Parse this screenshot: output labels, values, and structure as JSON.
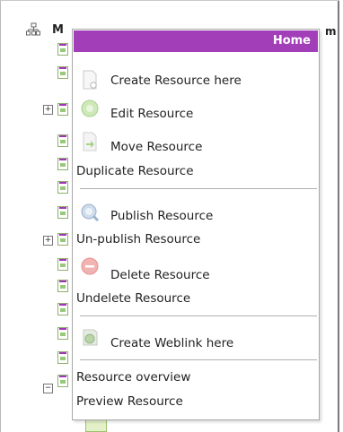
{
  "tree": {
    "root_label": "M",
    "root_suffix": "m"
  },
  "menu": {
    "title": "Home",
    "items": [
      {
        "label": "Create Resource here",
        "icon": "doc-new-icon"
      },
      {
        "label": "Edit Resource",
        "icon": "edit-icon"
      },
      {
        "label": "Move Resource",
        "icon": "move-arrow-icon"
      },
      {
        "label": "Duplicate Resource",
        "icon": ""
      },
      {
        "label": "Publish Resource",
        "icon": "publish-icon"
      },
      {
        "label": "Un-publish Resource",
        "icon": ""
      },
      {
        "label": "Delete Resource",
        "icon": "delete-icon"
      },
      {
        "label": "Undelete Resource",
        "icon": ""
      },
      {
        "label": "Create Weblink here",
        "icon": "weblink-icon"
      },
      {
        "label": "Resource overview",
        "icon": ""
      },
      {
        "label": "Preview Resource",
        "icon": ""
      }
    ]
  },
  "colors": {
    "header": "#a23fb8",
    "header_text": "#ffffff"
  }
}
